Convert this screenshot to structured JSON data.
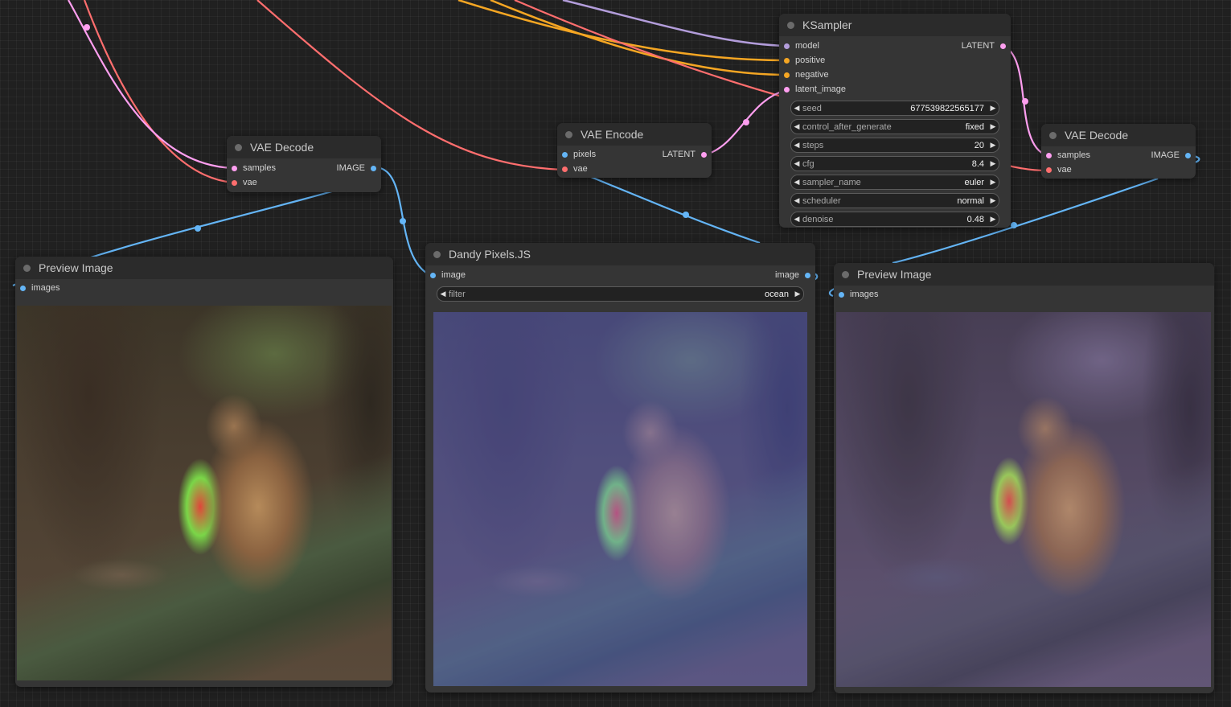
{
  "nodes": {
    "ksampler": {
      "title": "KSampler",
      "inputs": [
        "model",
        "positive",
        "negative",
        "latent_image"
      ],
      "output": "LATENT",
      "widgets": [
        {
          "label": "seed",
          "value": "677539822565177"
        },
        {
          "label": "control_after_generate",
          "value": "fixed"
        },
        {
          "label": "steps",
          "value": "20"
        },
        {
          "label": "cfg",
          "value": "8.4"
        },
        {
          "label": "sampler_name",
          "value": "euler"
        },
        {
          "label": "scheduler",
          "value": "normal"
        },
        {
          "label": "denoise",
          "value": "0.48"
        }
      ]
    },
    "vae_decode_left": {
      "title": "VAE Decode",
      "inputs": [
        "samples",
        "vae"
      ],
      "output": "IMAGE"
    },
    "vae_encode": {
      "title": "VAE Encode",
      "inputs": [
        "pixels",
        "vae"
      ],
      "output": "LATENT"
    },
    "vae_decode_right": {
      "title": "VAE Decode",
      "inputs": [
        "samples",
        "vae"
      ],
      "output": "IMAGE"
    },
    "preview_left": {
      "title": "Preview Image",
      "input": "images"
    },
    "dandy": {
      "title": "Dandy Pixels.JS",
      "input": "image",
      "output": "image",
      "widget": {
        "label": "filter",
        "value": "ocean"
      }
    },
    "preview_right": {
      "title": "Preview Image",
      "input": "images"
    }
  },
  "colors": {
    "model": "#b39ddb",
    "conditioning": "#f5a623",
    "latent": "#ff9ff0",
    "vae": "#ff6e6e",
    "image": "#64b5f6"
  },
  "icons": {
    "arrow_left": "◀",
    "arrow_right": "▶"
  }
}
